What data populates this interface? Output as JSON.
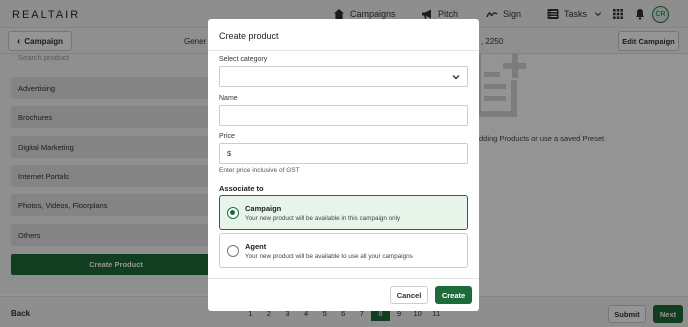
{
  "app": {
    "logo": "REALTAIR"
  },
  "nav": {
    "campaigns": "Campaigns",
    "pitch": "Pitch",
    "sign": "Sign",
    "tasks": "Tasks",
    "avatar_initials": "CR"
  },
  "subheader": {
    "back_label": "Campaign",
    "general_text": "Gener",
    "address_fragment": ", 2250",
    "edit_label": "Edit Campaign"
  },
  "left_panel": {
    "search_placeholder": "Search product",
    "categories": [
      "Advertising",
      "Brochures",
      "Digital Marketing",
      "Internet Portals",
      "Photos, Videos, Floorplans",
      "Others"
    ],
    "create_button": "Create Product"
  },
  "right_panel": {
    "empty_text": "dding Products or use a saved Preset"
  },
  "footer": {
    "back_label": "Back",
    "pages": [
      "1",
      "2",
      "3",
      "4",
      "5",
      "6",
      "7",
      "8",
      "9",
      "10",
      "11"
    ],
    "current_page": "8",
    "submit_label": "Submit",
    "next_label": "Next"
  },
  "modal": {
    "title": "Create product",
    "category_label": "Select category",
    "category_value": "",
    "name_label": "Name",
    "name_value": "",
    "price_label": "Price",
    "price_prefix": "$",
    "price_helper": "Enter price inclusive of GST",
    "associate_label": "Associate to",
    "options": [
      {
        "title": "Campaign",
        "description": "Your new product will be available in this campaign only",
        "selected": true
      },
      {
        "title": "Agent",
        "description": "Your new product will be available to use all your campaigns",
        "selected": false
      }
    ],
    "cancel_label": "Cancel",
    "create_label": "Create"
  },
  "colors": {
    "primary_green": "#1e6b3a",
    "selected_bg": "#e6f4ea",
    "overlay": "rgba(0,0,0,0.42)"
  }
}
